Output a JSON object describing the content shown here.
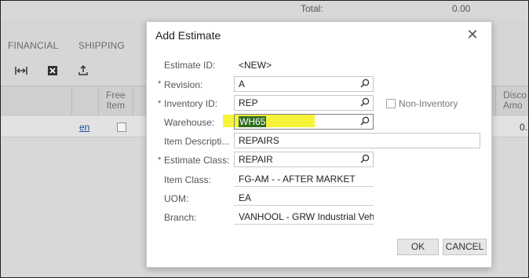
{
  "background": {
    "total_label": "Total:",
    "total_value": "0.00",
    "tabs": [
      "FINANCIAL",
      "SHIPPING"
    ],
    "toolbar_icons": [
      "fit-columns-icon",
      "export-excel-icon",
      "upload-icon"
    ],
    "grid_headers": {
      "free_item_line1": "Free",
      "free_item_line2": "Item",
      "discount_line1": "Disco",
      "discount_line2": "Amo"
    },
    "row": {
      "link": "en",
      "value": "0."
    }
  },
  "dialog": {
    "title": "Add Estimate",
    "fields": {
      "estimate_id_label": "Estimate ID:",
      "estimate_id_value": "<NEW>",
      "revision_label": "Revision:",
      "revision_value": "A",
      "inventory_id_label": "Inventory ID:",
      "inventory_id_value": "REP",
      "non_inventory_label": "Non-Inventory",
      "non_inventory_checked": false,
      "warehouse_label": "Warehouse:",
      "warehouse_value": "WH65",
      "item_description_label": "Item Descripti...",
      "item_description_value": "REPAIRS",
      "estimate_class_label": "Estimate Class:",
      "estimate_class_value": "REPAIR",
      "item_class_label": "Item Class:",
      "item_class_value": "FG-AM  - - AFTER MARKET",
      "uom_label": "UOM:",
      "uom_value": "EA",
      "branch_label": "Branch:",
      "branch_value": "VANHOOL - GRW Industrial Veh"
    },
    "required_marker": "*",
    "ok_label": "OK",
    "cancel_label": "CANCEL"
  },
  "colors": {
    "highlight": "#f6f43a",
    "selection": "#2f6d1f",
    "link": "#1a4fa0"
  }
}
